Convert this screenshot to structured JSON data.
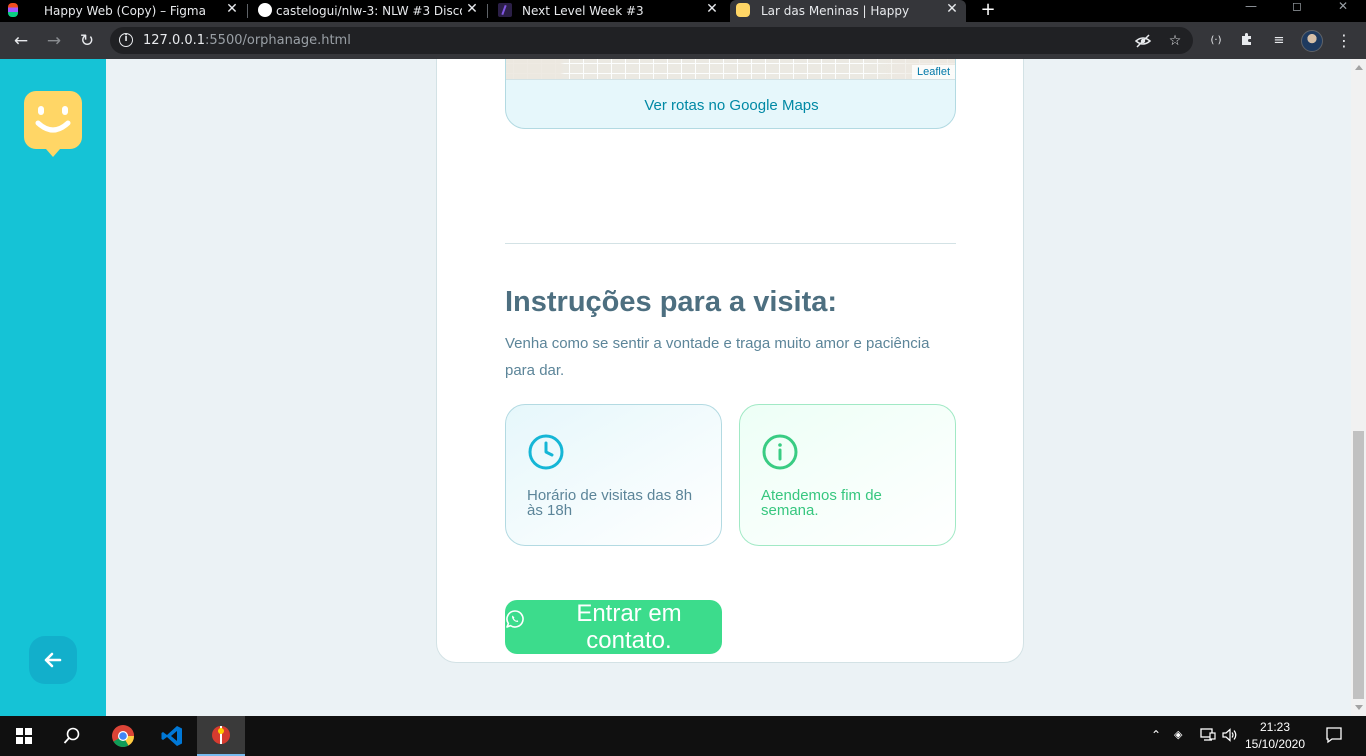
{
  "browser": {
    "tabs": [
      {
        "title": "Happy Web (Copy) – Figma",
        "close": "✕"
      },
      {
        "title": "castelogui/nlw-3: NLW #3 Discov",
        "close": "✕"
      },
      {
        "title": "Next Level Week #3",
        "close": "✕"
      },
      {
        "title": "Lar das Meninas | Happy",
        "close": "✕"
      }
    ],
    "new_tab": "+",
    "url_host": "127.0.0.1",
    "url_rest": ":5500/orphanage.html"
  },
  "map": {
    "attribution": "Leaflet",
    "routes_link": "Ver rotas no Google Maps"
  },
  "instructions": {
    "title": "Instruções para a visita:",
    "description": "Venha como se sentir a vontade e traga muito amor e paciência para dar.",
    "hours_text": "Horário de visitas das 8h às 18h",
    "weekend_text": "Atendemos fim de semana."
  },
  "contact": {
    "button_label": "Entrar em contato."
  },
  "taskbar": {
    "time": "21:23",
    "date": "15/10/2020"
  },
  "colors": {
    "sidebar": "#15c3d6",
    "logo": "#ffd666",
    "primary_text": "#4d6f80",
    "contact_green": "#3cdc8c"
  }
}
